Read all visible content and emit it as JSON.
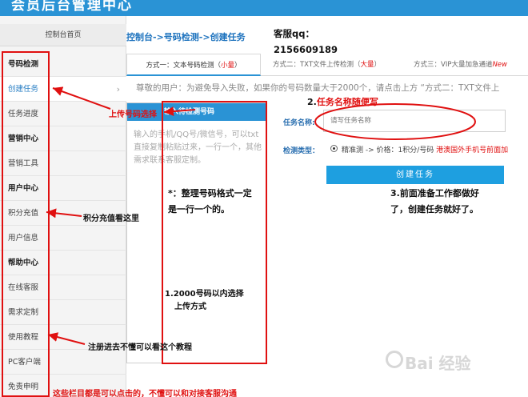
{
  "header": {
    "title": "会员后台管理中心"
  },
  "sidebar": {
    "home": "控制台首页",
    "items": [
      {
        "label": "号码检测",
        "type": "head"
      },
      {
        "label": "创建任务",
        "type": "active"
      },
      {
        "label": "任务进度",
        "type": "item"
      },
      {
        "label": "营销中心",
        "type": "head"
      },
      {
        "label": "营销工具",
        "type": "item"
      },
      {
        "label": "用户中心",
        "type": "head"
      },
      {
        "label": "积分充值",
        "type": "item"
      },
      {
        "label": "用户信息",
        "type": "item"
      },
      {
        "label": "帮助中心",
        "type": "head"
      },
      {
        "label": "在线客服",
        "type": "item"
      },
      {
        "label": "需求定制",
        "type": "item"
      },
      {
        "label": "使用教程",
        "type": "item"
      },
      {
        "label": "PC客户端",
        "type": "item"
      },
      {
        "label": "免责申明",
        "type": "item"
      }
    ]
  },
  "breadcrumb": "控制台->号码检测->创建任务",
  "qq": {
    "label": "客服qq：",
    "number": "2156609189"
  },
  "tabs": [
    {
      "prefix": "方式一：文本号码检测（",
      "highlight": "小量",
      "suffix": "）"
    },
    {
      "prefix": "方式二：TXT文件上传检测（",
      "highlight": "大量",
      "suffix": "）"
    },
    {
      "prefix": "方式三：VIP大量加急通道",
      "highlight": "New",
      "suffix": ""
    }
  ],
  "notice": "尊敬的用户：为避免导入失败，如果你的号码数量大于2000个，请点击上方 “方式二：TXT文件上",
  "upload": {
    "header": "输入待检测号码",
    "placeholder": "输入的手机/QQ号/微信号，可以txt直接复制粘贴过来，一行一个，其他需求联系客服定制。"
  },
  "form": {
    "task_name_label": "任务名称:",
    "task_name_placeholder": "请写任务名称",
    "detect_type_label": "检测类型：",
    "detect_option": "精准测 -> 价格：1积分/号码",
    "detect_option_red": "港澳国外手机号前面加",
    "create_button": "创建任务"
  },
  "annotations": {
    "upload_select": "上传号码选择",
    "task_name_tip_number": "2.",
    "task_name_tip": "任务名称随便写",
    "format_tip_line1": "*：整理号码格式一定",
    "format_tip_line2": "是一行一个的。",
    "create_tip_line1": "3.前面准备工作都做好",
    "create_tip_line2": "了，创建任务就好了。",
    "points_tip": "积分充值看这里",
    "upload_tip_line1": "1.2000号码以内选择",
    "upload_tip_line2": "上传方式",
    "tutorial_tip": "注册进去不懂可以看这个教程",
    "bottom_tip": "这些栏目都是可以点击的，不懂可以和对接客服沟通"
  },
  "watermark": "Bai 经验",
  "colors": {
    "brand_blue": "#2a93d5",
    "annotation_red": "#e01010",
    "link_blue": "#1e73be"
  }
}
